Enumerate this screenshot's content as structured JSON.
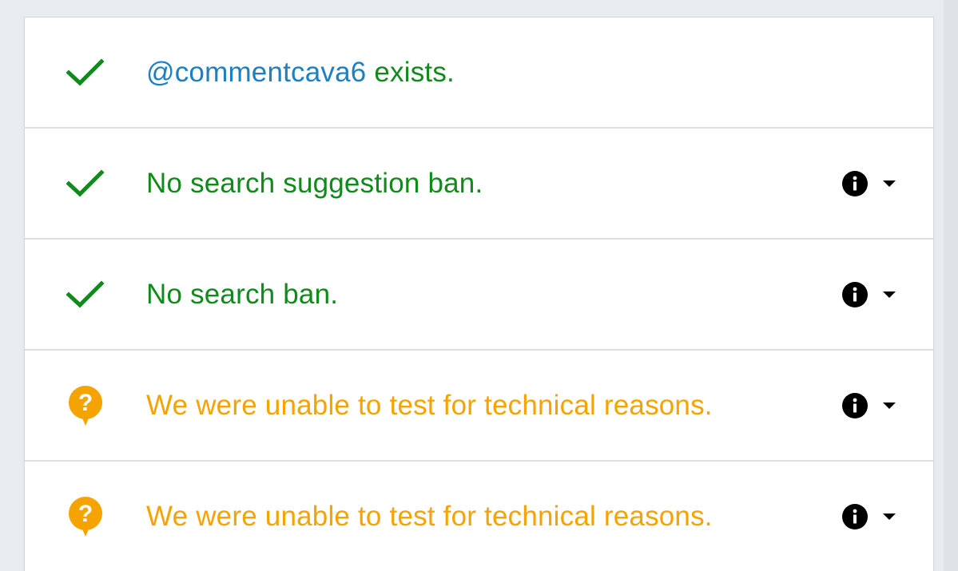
{
  "colors": {
    "ok": "#108a1a",
    "warn": "#f5a300",
    "handle": "#1d80c3"
  },
  "rows": [
    {
      "status": "ok",
      "icon": "check-icon",
      "handle": "@commentcava6",
      "text": " exists.",
      "has_actions": false
    },
    {
      "status": "ok",
      "icon": "check-icon",
      "text": "No search suggestion ban.",
      "has_actions": true
    },
    {
      "status": "ok",
      "icon": "check-icon",
      "text": "No search ban.",
      "has_actions": true
    },
    {
      "status": "warn",
      "icon": "question-bubble-icon",
      "text": "We were unable to test for technical reasons.",
      "has_actions": true
    },
    {
      "status": "warn",
      "icon": "question-bubble-icon",
      "text": "We were unable to test for technical reasons.",
      "has_actions": true
    }
  ]
}
